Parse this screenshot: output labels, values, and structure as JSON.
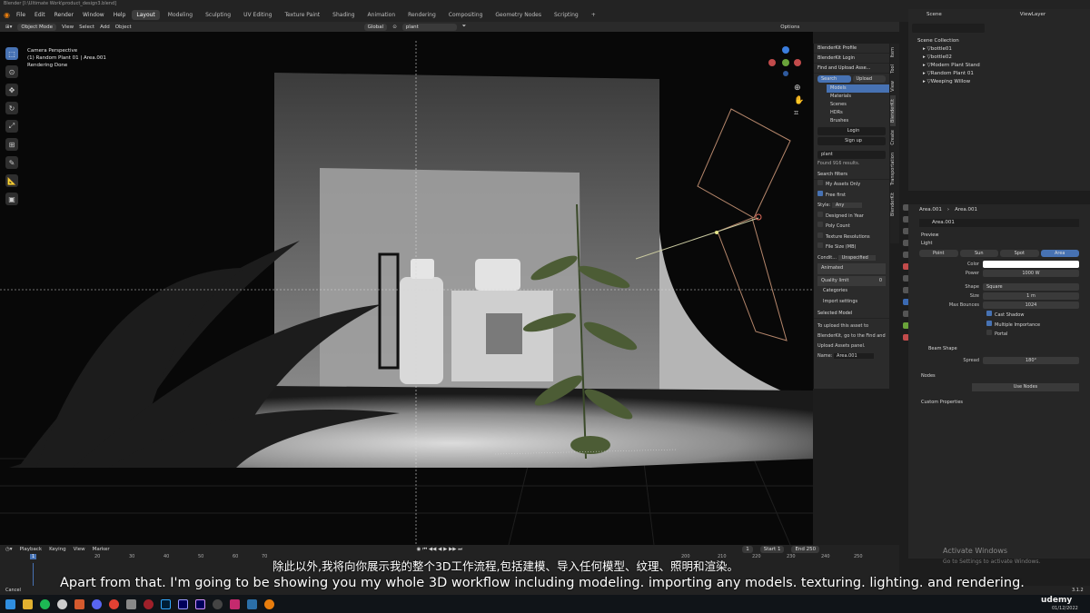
{
  "window": {
    "title": "Blender [I:\\Ultimate Work\\product_design3.blend]"
  },
  "menu": [
    "File",
    "Edit",
    "Render",
    "Window",
    "Help"
  ],
  "workspaces": [
    "Layout",
    "Modeling",
    "Sculpting",
    "UV Editing",
    "Texture Paint",
    "Shading",
    "Animation",
    "Rendering",
    "Compositing",
    "Geometry Nodes",
    "Scripting"
  ],
  "header": {
    "mode": "Object Mode",
    "items": [
      "View",
      "Select",
      "Add",
      "Object"
    ],
    "orientation": "Global",
    "search_value": "plant",
    "options": "Options"
  },
  "viewport": {
    "line1": "Camera Perspective",
    "line2": "(1) Random Plant 01 | Area.001",
    "line3": "Rendering Done"
  },
  "npanel": {
    "profile": "BlenderKit Profile",
    "login_hdr": "BlenderKit Login",
    "find_upload": "Find and Upload Asse...",
    "search_btn": "Search",
    "upload_btn": "Upload",
    "categories": [
      "Models",
      "Materials",
      "Scenes",
      "HDRs",
      "Brushes"
    ],
    "login": "Login",
    "signup": "Sign up",
    "search_value": "plant",
    "found": "Found 916 results.",
    "filters": "Search filters",
    "my_assets": "My Assets Only",
    "free_first": "Free first",
    "style_label": "Style:",
    "style_value": "Any",
    "designed": "Designed in Year",
    "poly": "Poly Count",
    "texres": "Texture Resolutions",
    "filesize": "File Size (MB)",
    "cond_label": "Condit...",
    "cond_value": "Unspecified",
    "animated": "Animated",
    "quality_label": "Quality limit",
    "quality_value": "0",
    "cat_toggle": "Categories",
    "import_settings": "Import settings",
    "selected_model": "Selected Model",
    "upload_info": [
      "To upload this asset to",
      "BlenderKit, go to the Find and",
      "Upload Assets panel."
    ],
    "name_label": "Name:",
    "name_value": "Area.001"
  },
  "vtabs": [
    "Item",
    "Tool",
    "View",
    "BlenderKit",
    "Create",
    "Transportation",
    "BlenderKit"
  ],
  "outliner": {
    "scene": "Scene",
    "viewlayer": "ViewLayer",
    "collection": "Scene Collection",
    "items": [
      "bottle01",
      "bottle02",
      "Modern Plant Stand",
      "Random Plant 01",
      "Weeping Willow"
    ]
  },
  "properties": {
    "crumb1": "Area.001",
    "crumb2": "Area.001",
    "name": "Area.001",
    "preview": "Preview",
    "light": "Light",
    "light_types": [
      "Point",
      "Sun",
      "Spot",
      "Area"
    ],
    "color_label": "Color",
    "power_label": "Power",
    "power_value": "1000 W",
    "shape_label": "Shape",
    "shape_value": "Square",
    "size_label": "Size",
    "size_value": "1 m",
    "bounces_label": "Max Bounces",
    "bounces_value": "1024",
    "cast_shadow": "Cast Shadow",
    "multi_imp": "Multiple Importance",
    "portal": "Portal",
    "beam": "Beam Shape",
    "spread_label": "Spread",
    "spread_value": "180°",
    "nodes": "Nodes",
    "use_nodes": "Use Nodes",
    "custom": "Custom Properties"
  },
  "timeline": {
    "playback": "Playback",
    "keying": "Keying",
    "view": "View",
    "marker": "Marker",
    "frame": "1",
    "start_label": "Start",
    "start": "1",
    "end_label": "End",
    "end": "250",
    "ticks": [
      "1",
      "20",
      "30",
      "40",
      "50",
      "60",
      "70",
      "200",
      "210",
      "220",
      "230",
      "240",
      "250"
    ]
  },
  "status": {
    "cancel": "Cancel",
    "version": "3.1.2"
  },
  "subtitles": {
    "zh": "除此以外,我将向你展示我的整个3D工作流程,包括建模、导入任何模型、纹理、照明和渲染。",
    "en": "Apart from that. I'm going to be showing you my whole 3D workflow including modeling. importing any models. texturing. lighting. and rendering."
  },
  "activate": {
    "title": "Activate Windows",
    "sub": "Go to Settings to activate Windows."
  },
  "taskbar": {
    "date": "01/12/2022",
    "udemy": "udemy"
  },
  "colors": {
    "accent": "#4772b3",
    "light_color": "#ffffff"
  }
}
